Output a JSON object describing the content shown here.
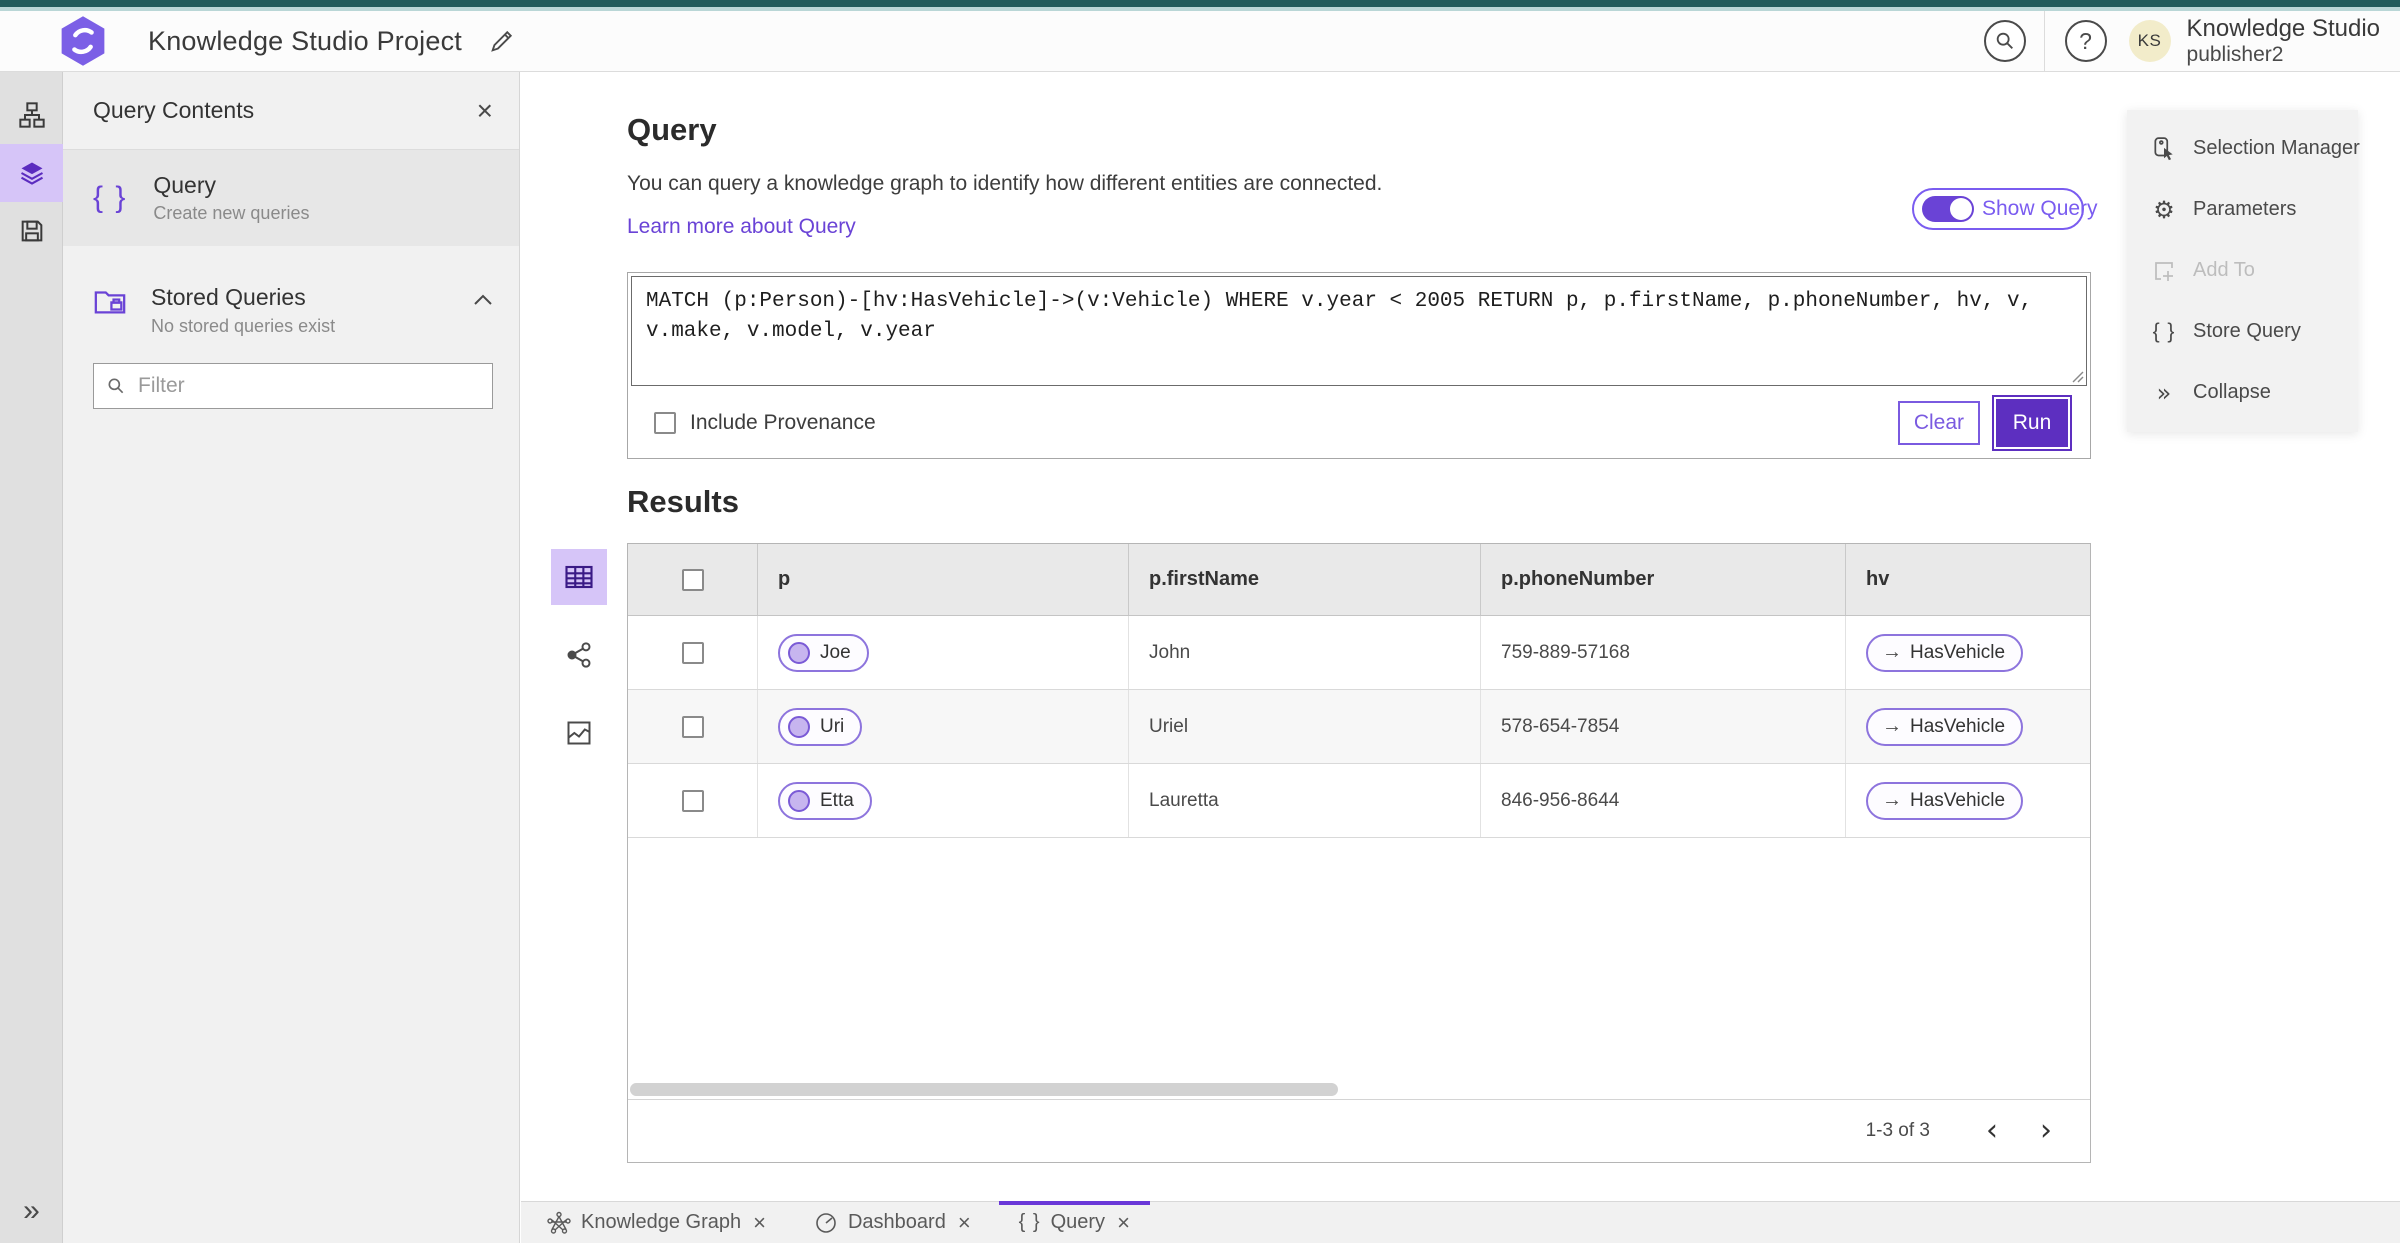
{
  "topbar": {
    "title": "Knowledge Studio Project",
    "user_name": "Knowledge Studio",
    "user_sub": "publisher2",
    "avatar_initials": "KS"
  },
  "icons": {
    "close": "×",
    "double_chevron_right": "»",
    "braces": "{ }",
    "arrow_right": "→",
    "chevron_left": "‹",
    "chevron_right": "›",
    "help": "?",
    "gear": "⚙"
  },
  "panel": {
    "title": "Query Contents",
    "query_item": {
      "title": "Query",
      "subtitle": "Create new queries"
    },
    "stored": {
      "title": "Stored Queries",
      "subtitle": "No stored queries exist"
    },
    "filter_placeholder": "Filter"
  },
  "query": {
    "heading": "Query",
    "description": "You can query a knowledge graph to identify how different entities are connected.",
    "link": "Learn more about Query",
    "toggle_label": "Show Query",
    "query_text": "MATCH (p:Person)-[hv:HasVehicle]->(v:Vehicle) WHERE v.year < 2005 RETURN p, p.firstName, p.phoneNumber, hv, v, v.make, v.model, v.year",
    "include_provenance": "Include Provenance",
    "clear": "Clear",
    "run": "Run"
  },
  "results": {
    "heading": "Results",
    "columns": [
      "p",
      "p.firstName",
      "p.phoneNumber",
      "hv"
    ],
    "rows": [
      {
        "p": "Joe",
        "firstName": "John",
        "phone": "759-889-57168",
        "hv": "HasVehicle"
      },
      {
        "p": "Uri",
        "firstName": "Uriel",
        "phone": "578-654-7854",
        "hv": "HasVehicle"
      },
      {
        "p": "Etta",
        "firstName": "Lauretta",
        "phone": "846-956-8644",
        "hv": "HasVehicle"
      }
    ],
    "pagination": "1-3 of 3"
  },
  "side_panel": {
    "items": [
      {
        "label": "Selection Manager",
        "disabled": false
      },
      {
        "label": "Parameters",
        "disabled": false
      },
      {
        "label": "Add To",
        "disabled": true
      },
      {
        "label": "Store Query",
        "disabled": false
      },
      {
        "label": "Collapse",
        "disabled": false
      }
    ]
  },
  "tabs": [
    {
      "label": "Knowledge Graph"
    },
    {
      "label": "Dashboard"
    },
    {
      "label": "Query"
    }
  ],
  "colors": {
    "accent_purple": "#6a43d6",
    "run_purple": "#5d2fc0",
    "icon_purple": "#5b2cbf",
    "topbar_teal": "#215b5b",
    "rail_selected_bg": "#d6c5f8",
    "avatar_bg": "#f2ecca",
    "link_purple": "#6a43d6"
  }
}
